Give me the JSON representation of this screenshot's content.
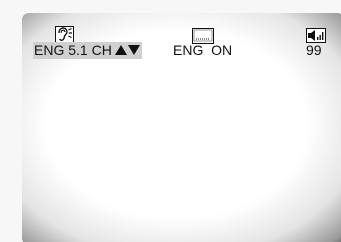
{
  "osd": {
    "audio_language": "ENG 5.1 CH",
    "audio_language_arrows": "▲▼",
    "subtitle_language": "ENG",
    "subtitle_state": "ON",
    "volume": "99"
  },
  "icons": {
    "audio": "ear-icon",
    "subtitle": "subtitle-screen-icon",
    "volume": "speaker-volume-icon"
  },
  "colors": {
    "selection_highlight": "#d0d0d0",
    "text": "#111111",
    "screen_background": "#ffffff"
  }
}
